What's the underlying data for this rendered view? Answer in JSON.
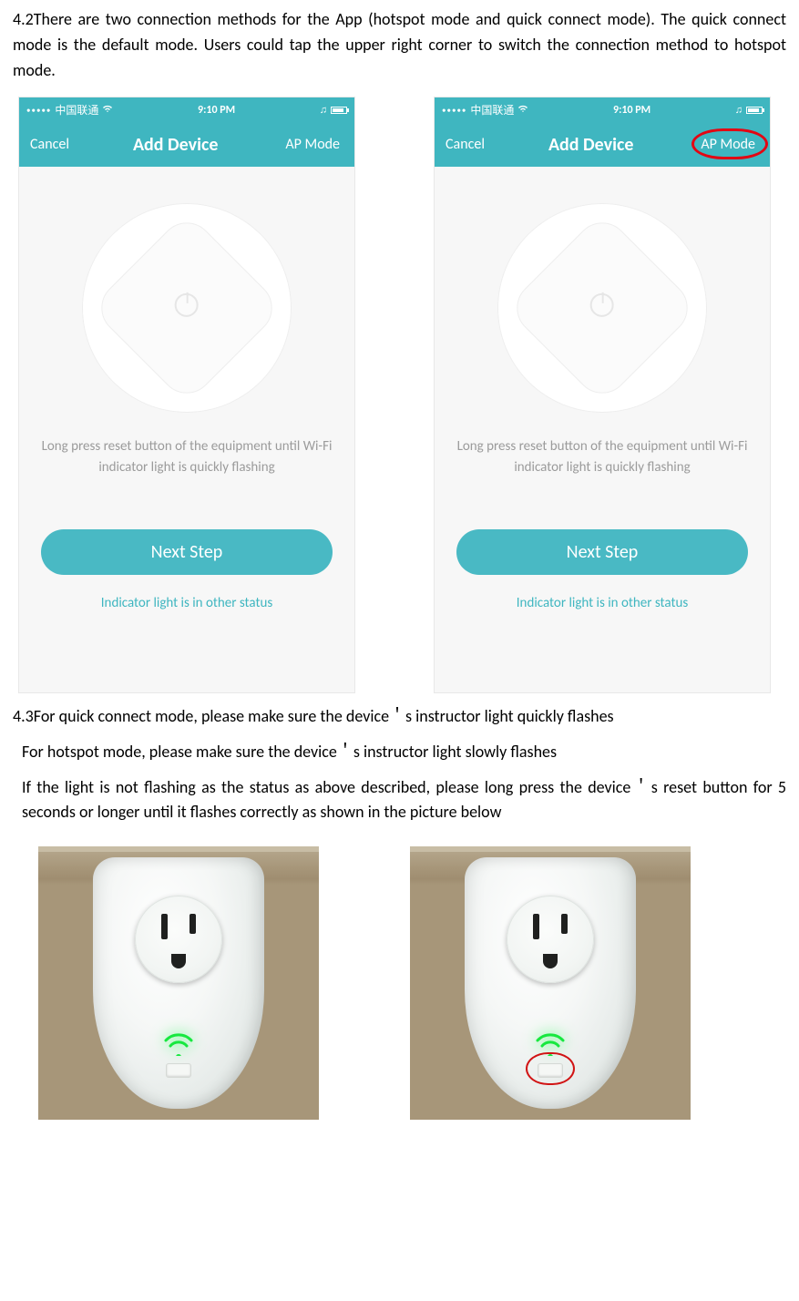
{
  "doc": {
    "p42": "4.2There are two connection methods for the App (hotspot mode and quick connect mode). The quick connect mode is the default mode. Users could tap the upper right corner to switch the connection method to hotspot mode.",
    "p43a": "4.3For quick connect mode, please make sure the device＇s instructor light quickly flashes",
    "p43b": "For hotspot mode, please make sure the device＇s instructor light slowly flashes",
    "p43c": "If the light is not flashing as the status as above described, please long press the device＇s reset button for 5 seconds or longer until it flashes correctly as shown in the picture below"
  },
  "phone": {
    "status": {
      "carrier": "中国联通",
      "time": "9:10 PM"
    },
    "nav": {
      "cancel": "Cancel",
      "title": "Add Device",
      "mode": "AP Mode"
    },
    "hint": "Long press reset button of the equipment until Wi-Fi indicator light is quickly flashing",
    "next": "Next Step",
    "other": "Indicator light is in other status"
  }
}
